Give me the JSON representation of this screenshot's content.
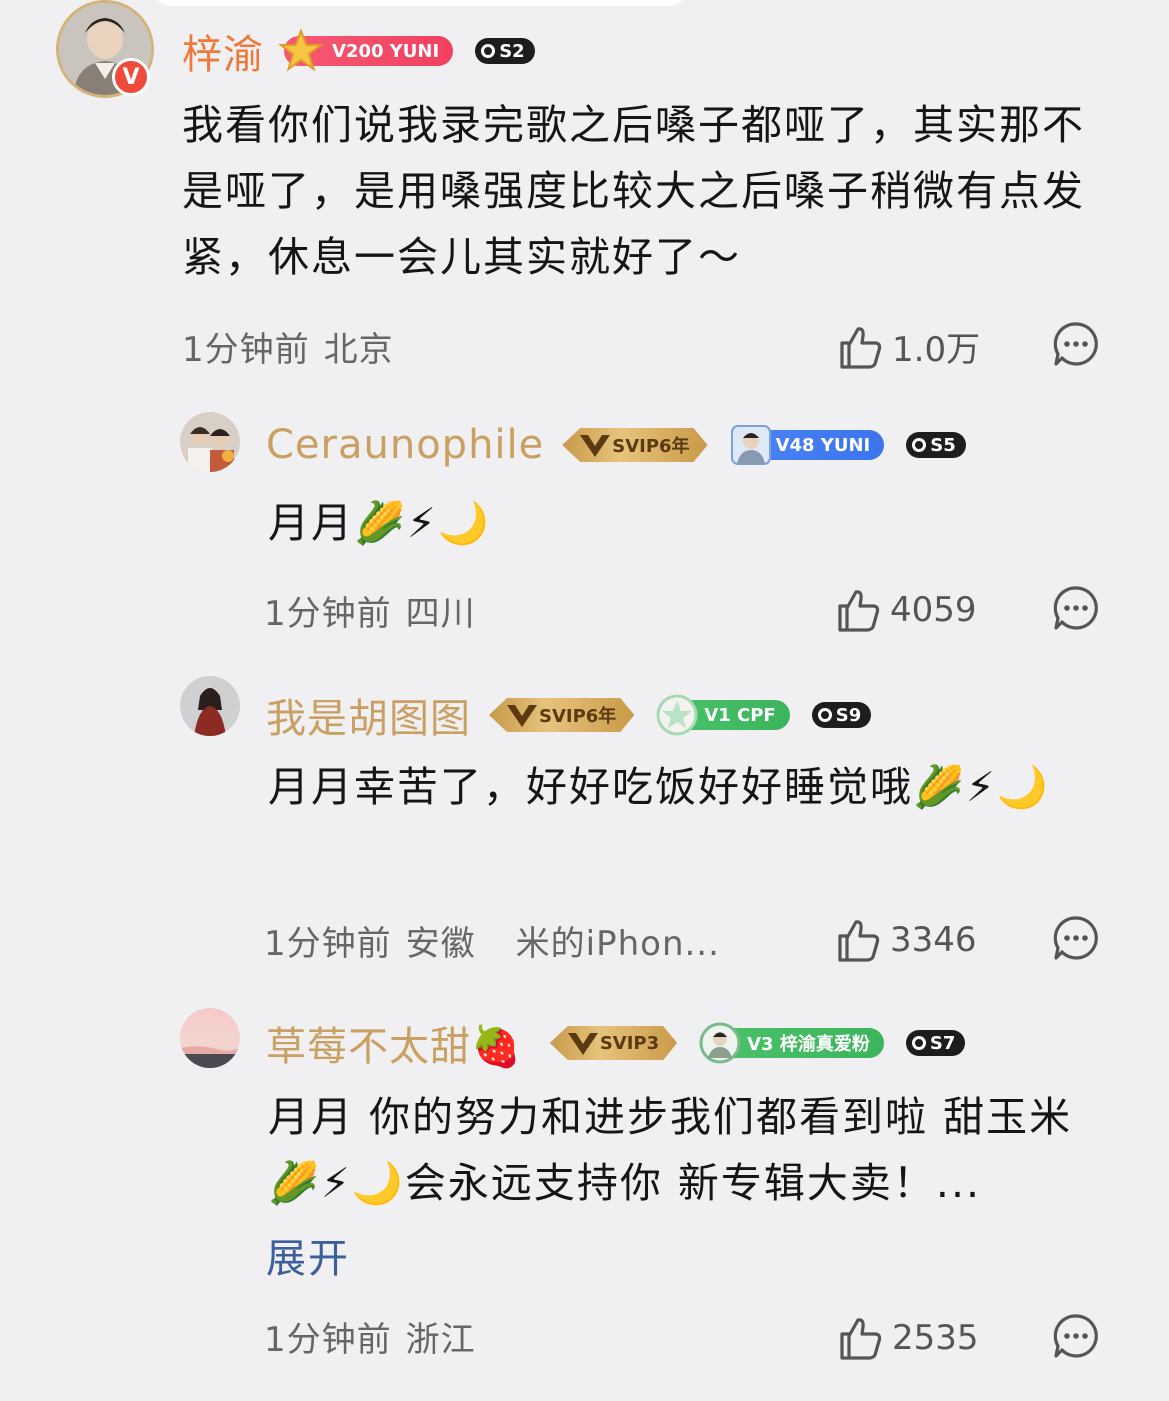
{
  "comments": [
    {
      "username": "梓渝",
      "level_badge": "V200 YUNI",
      "s_badge": "S2",
      "text": "我看你们说我录完歌之后嗓子都哑了，其实那不是哑了，是用嗓强度比较大之后嗓子稍微有点发紧，休息一会儿其实就好了～",
      "time": "1分钟前",
      "location": "北京",
      "likes": "1.0万",
      "verified_mark": "V"
    },
    {
      "username": "Ceraunophile",
      "svip_badge": "SVIP6年",
      "level_badge": "V48 YUNI",
      "s_badge": "S5",
      "text": "月月🌽⚡🌙",
      "time": "1分钟前",
      "location": "四川",
      "likes": "4059"
    },
    {
      "username": "我是胡图图",
      "svip_badge": "SVIP6年",
      "level_badge": "V1 CPF",
      "s_badge": "S9",
      "text": "月月幸苦了，好好吃饭好好睡觉哦🌽⚡🌙",
      "time": "1分钟前",
      "location": "安徽",
      "device": "米的iPhon...",
      "likes": "3346"
    },
    {
      "username": "草莓不太甜🍓",
      "svip_badge": "SVIP3",
      "level_badge": "V3 梓渝真爱粉",
      "s_badge": "S7",
      "text": "月月 你的努力和进步我们都看到啦 甜玉米🌽⚡🌙会永远支持你 新专辑大卖！...",
      "expand_label": "展开",
      "time": "1分钟前",
      "location": "浙江",
      "likes": "2535"
    }
  ],
  "colors": {
    "background": "#f0f0f2",
    "main_username": "#ed7a3b",
    "reply_username": "#c9a061",
    "expand_link": "#3b5e9c"
  },
  "icons": [
    "thumbs-up-icon",
    "comment-bubble-icon",
    "verified-v-icon"
  ]
}
